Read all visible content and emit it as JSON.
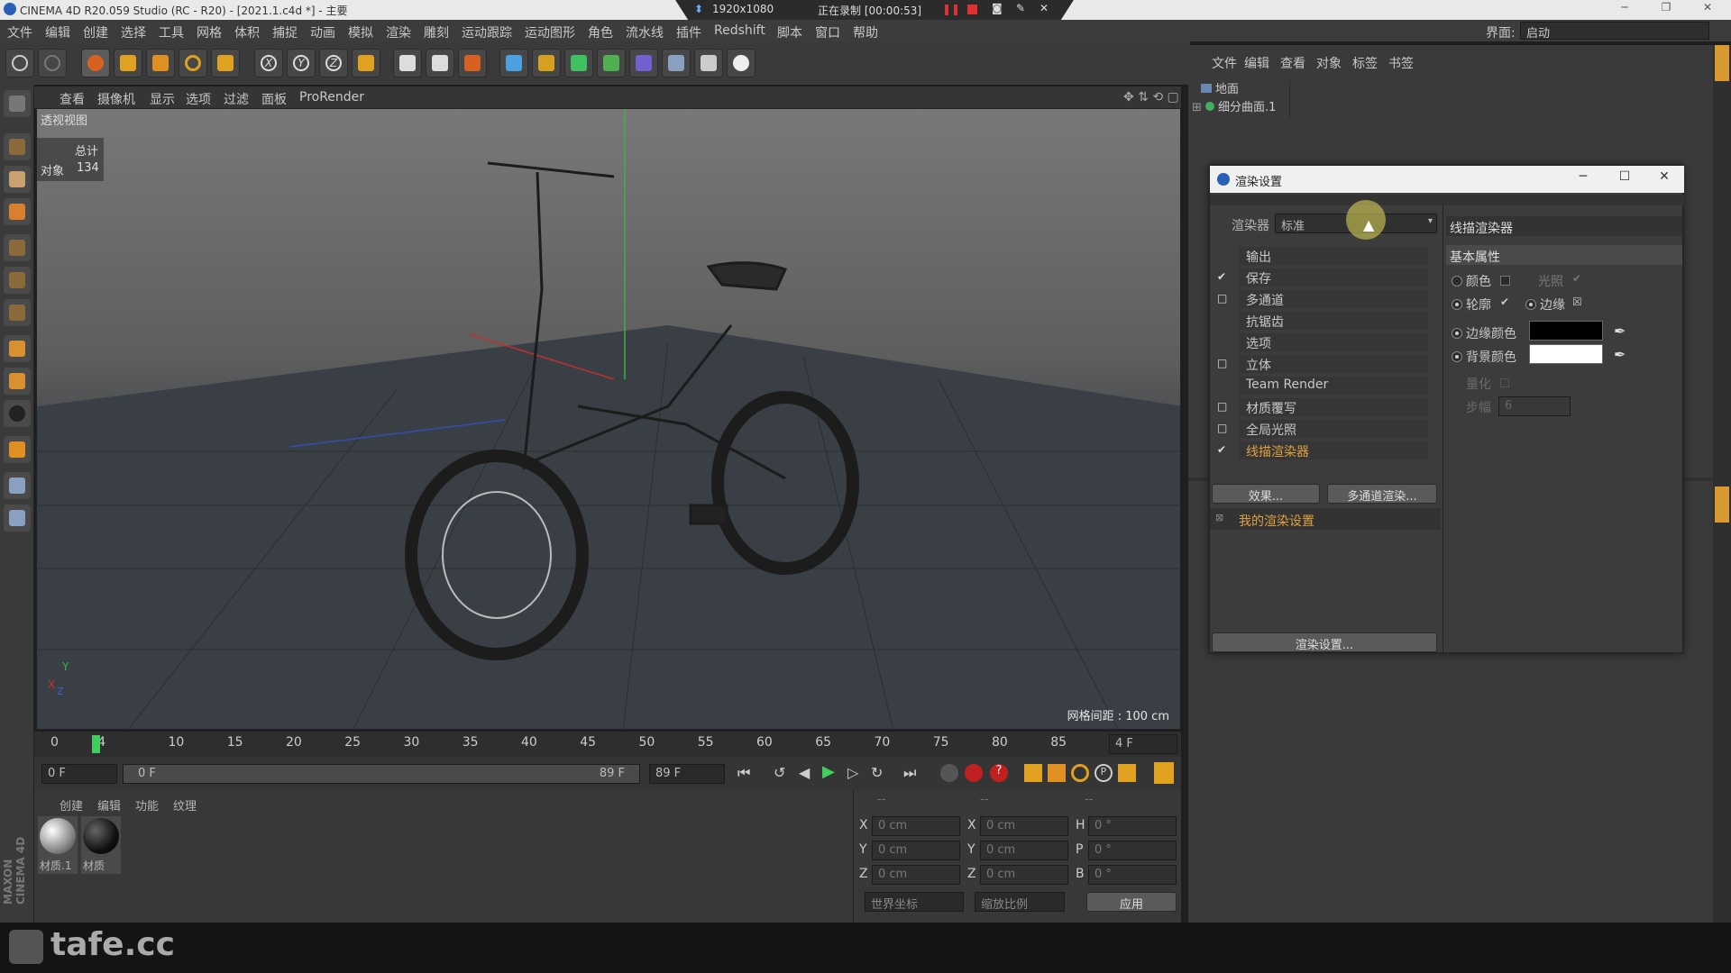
{
  "window": {
    "title": "CINEMA 4D R20.059 Studio (RC - R20) - [2021.1.c4d *] - 主要",
    "recording_size": "1920x1080",
    "recording_status": "正在录制 [00:00:53]"
  },
  "menu": [
    "文件",
    "编辑",
    "创建",
    "选择",
    "工具",
    "网格",
    "体积",
    "捕捉",
    "动画",
    "模拟",
    "渲染",
    "雕刻",
    "运动跟踪",
    "运动图形",
    "角色",
    "流水线",
    "插件",
    "Redshift",
    "脚本",
    "窗口",
    "帮助"
  ],
  "layout": {
    "label": "界面:",
    "value": "启动"
  },
  "viewport": {
    "menu": [
      "查看",
      "摄像机",
      "显示",
      "选项",
      "过滤",
      "面板",
      "ProRender"
    ],
    "name": "透视视图",
    "stats_header": "总计",
    "stats_label": "对象",
    "stats_value": "134",
    "grid_spacing": "网格间距 : 100 cm",
    "axis_y": "Y",
    "axis_x": "X",
    "axis_z": "Z"
  },
  "timeline": {
    "ticks": [
      "0",
      "4",
      "10",
      "15",
      "20",
      "25",
      "30",
      "35",
      "40",
      "45",
      "50",
      "55",
      "60",
      "65",
      "70",
      "75",
      "80",
      "85"
    ],
    "current_frame": "4 F",
    "start_field": "0 F",
    "range_start": "0 F",
    "range_end": "89 F",
    "end_field": "89 F"
  },
  "materials": {
    "menu": [
      "创建",
      "编辑",
      "功能",
      "纹理"
    ],
    "items": [
      "材质.1",
      "材质"
    ]
  },
  "coords": {
    "headers": [
      "--",
      "--",
      "--"
    ],
    "rows": [
      {
        "a": "X",
        "av": "0 cm",
        "b": "X",
        "bv": "0 cm",
        "c": "H",
        "cv": "0 °"
      },
      {
        "a": "Y",
        "av": "0 cm",
        "b": "Y",
        "bv": "0 cm",
        "c": "P",
        "cv": "0 °"
      },
      {
        "a": "Z",
        "av": "0 cm",
        "b": "Z",
        "bv": "0 cm",
        "c": "B",
        "cv": "0 °"
      }
    ],
    "world": "世界坐标",
    "scale": "缩放比例",
    "apply": "应用"
  },
  "objects": {
    "menu": [
      "文件",
      "编辑",
      "查看",
      "对象",
      "标签",
      "书签"
    ],
    "items": [
      "地面",
      "细分曲面.1"
    ]
  },
  "render_dialog": {
    "title": "渲染设置",
    "renderer_label": "渲染器",
    "renderer_value": "标准",
    "section": "线描渲染器",
    "group": "基本属性",
    "nav": [
      {
        "label": "输出",
        "check": ""
      },
      {
        "label": "保存",
        "check": "✔"
      },
      {
        "label": "多通道",
        "check": "□"
      },
      {
        "label": "抗锯齿",
        "check": ""
      },
      {
        "label": "选项",
        "check": ""
      },
      {
        "label": "立体",
        "check": "□"
      },
      {
        "label": "Team Render",
        "check": ""
      },
      {
        "label": "材质覆写",
        "check": "□"
      },
      {
        "label": "全局光照",
        "check": "□"
      },
      {
        "label": "线描渲染器",
        "check": "✔"
      }
    ],
    "effects_btn": "效果...",
    "multipass_btn": "多通道渲染...",
    "preset": "我的渲染设置",
    "settings_btn": "渲染设置...",
    "props": {
      "color": "颜色",
      "illum": "光照",
      "contour": "轮廓",
      "edge": "边缘",
      "edge_color": "边缘颜色",
      "bg_color": "背景颜色",
      "quantize": "量化",
      "steps": "步幅",
      "steps_value": "6"
    }
  },
  "watermark": "tafe.cc",
  "maxon": "MAXON CINEMA 4D"
}
